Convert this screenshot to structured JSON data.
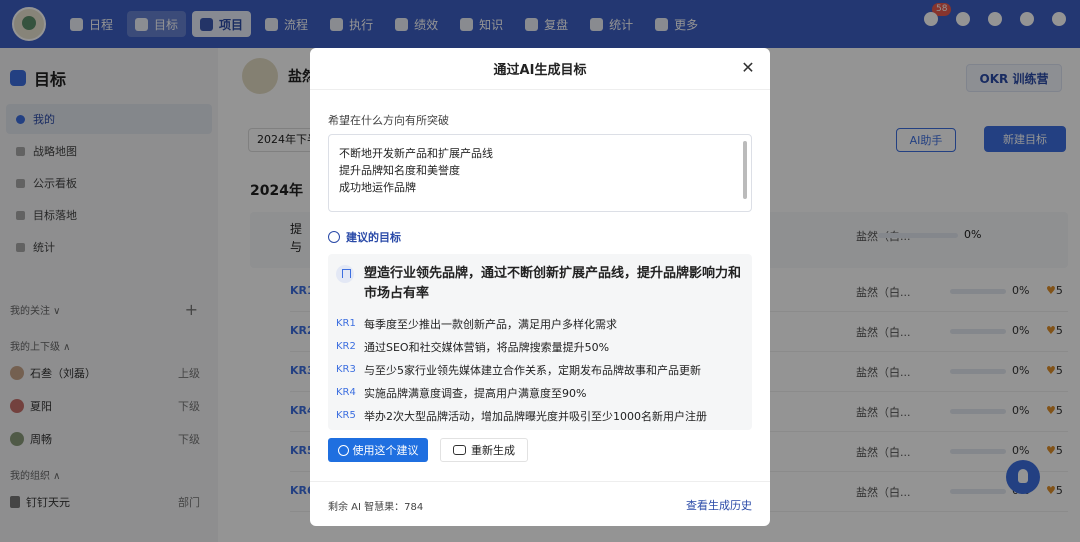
{
  "nav": {
    "items": [
      {
        "label": "日程",
        "icon": "calendar-icon"
      },
      {
        "label": "目标",
        "icon": "target-icon",
        "active": true
      },
      {
        "label": "项目",
        "icon": "cube-icon",
        "highlight": true
      },
      {
        "label": "流程",
        "icon": "flow-icon"
      },
      {
        "label": "执行",
        "icon": "execute-icon"
      },
      {
        "label": "绩效",
        "icon": "performance-icon"
      },
      {
        "label": "知识",
        "icon": "book-icon"
      },
      {
        "label": "复盘",
        "icon": "review-icon"
      },
      {
        "label": "统计",
        "icon": "pie-icon"
      },
      {
        "label": "更多",
        "icon": "grid-icon"
      }
    ],
    "notification_count": "58"
  },
  "sidebar": {
    "title": "目标",
    "items": [
      {
        "label": "我的",
        "active": true
      },
      {
        "label": "战略地图"
      },
      {
        "label": "公示看板"
      },
      {
        "label": "目标落地"
      },
      {
        "label": "统计"
      }
    ],
    "follow_label": "我的关注 ∨",
    "follow_add": "+",
    "relations_label": "我的上下级 ∧",
    "people": [
      {
        "name": "石叁（刘磊）",
        "role": "上级"
      },
      {
        "name": "夏阳",
        "role": "下级"
      },
      {
        "name": "周畅",
        "role": "下级"
      }
    ],
    "org_label": "我的组织 ∧",
    "org": {
      "name": "钉钉天元",
      "role": "部门"
    }
  },
  "main": {
    "user_name": "盐然",
    "okr_logo": "OKR 训练营",
    "period": "2024年下半",
    "ai_button": "AI助手",
    "new_button": "新建目标",
    "period_group": "2024年",
    "objective_line1": "提",
    "objective_line2": "与",
    "objective_owner": "盐然（白...",
    "objective_pct": "0%",
    "kr_rows": [
      {
        "tag": "KR1",
        "owner": "盐然（白...",
        "pct": "0%",
        "score": "5"
      },
      {
        "tag": "KR2",
        "owner": "盐然（白...",
        "pct": "0%",
        "score": "5"
      },
      {
        "tag": "KR3",
        "owner": "盐然（白...",
        "pct": "0%",
        "score": "5"
      },
      {
        "tag": "KR4",
        "owner": "盐然（白...",
        "pct": "0%",
        "score": "5"
      },
      {
        "tag": "KR5",
        "owner": "盐然（白...",
        "pct": "0%",
        "score": "5"
      },
      {
        "tag": "KR6",
        "owner": "盐然（白...",
        "pct": "0%",
        "score": "5"
      }
    ]
  },
  "modal": {
    "title": "通过AI生成目标",
    "prompt_label": "希望在什么方向有所突破",
    "prompt_lines": [
      "不断地开发新产品和扩展产品线",
      "提升品牌知名度和美誉度",
      "成功地运作品牌"
    ],
    "suggestion_label": "建议的目标",
    "objective": "塑造行业领先品牌，通过不断创新扩展产品线，提升品牌影响力和市场占有率",
    "krs": [
      {
        "tag": "KR1",
        "text": "每季度至少推出一款创新产品，满足用户多样化需求"
      },
      {
        "tag": "KR2",
        "text": "通过SEO和社交媒体营销，将品牌搜索量提升50%"
      },
      {
        "tag": "KR3",
        "text": "与至少5家行业领先媒体建立合作关系，定期发布品牌故事和产品更新"
      },
      {
        "tag": "KR4",
        "text": "实施品牌满意度调查，提高用户满意度至90%"
      },
      {
        "tag": "KR5",
        "text": "举办2次大型品牌活动，增加品牌曝光度并吸引至少1000名新用户注册"
      }
    ],
    "use_button": "使用这个建议",
    "regen_button": "重新生成",
    "remaining": "剩余 AI 智慧果：784",
    "history_link": "查看生成历史"
  }
}
